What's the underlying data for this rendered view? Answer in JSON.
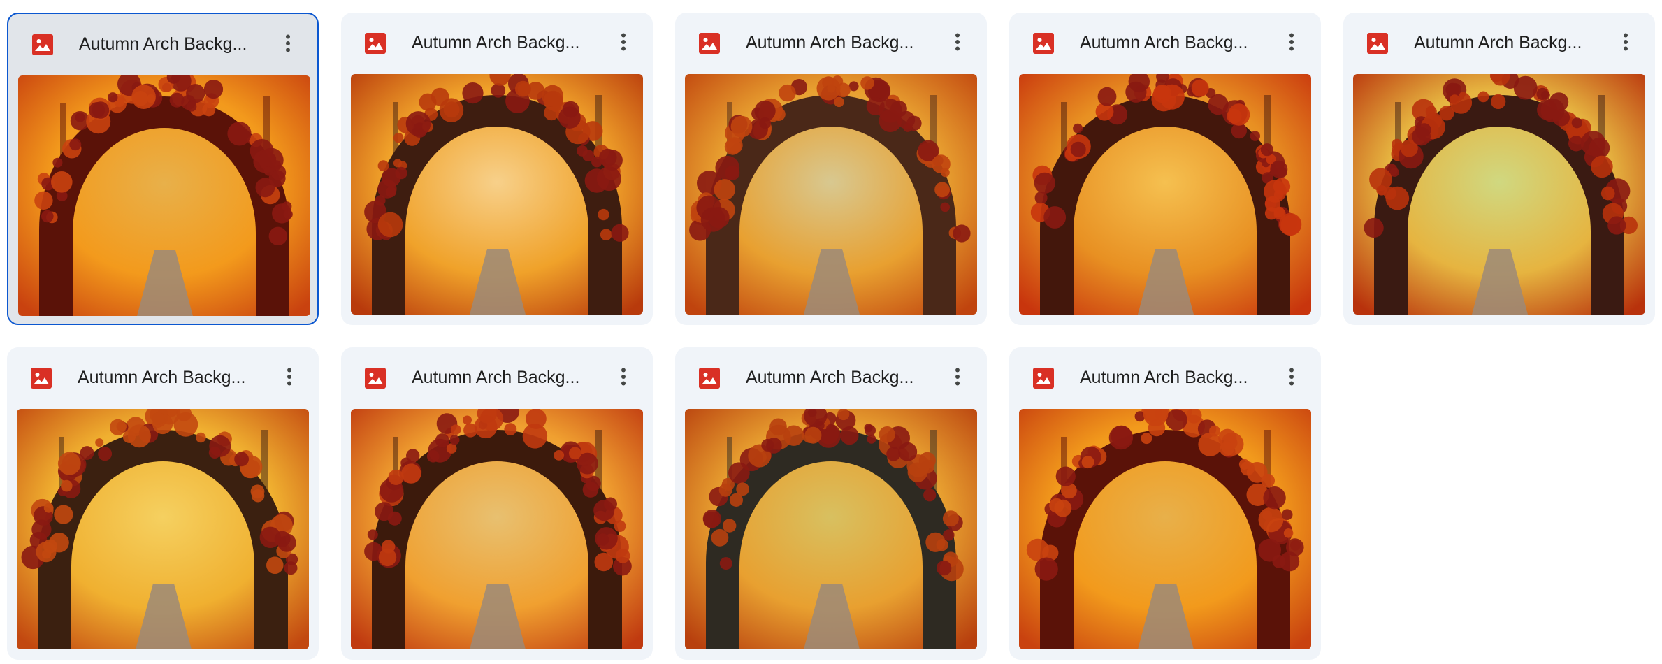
{
  "colors": {
    "card_bg": "#f0f4f9",
    "card_selected_bg": "#e1e5ea",
    "selection_border": "#0b57d0",
    "image_icon": "#d93025",
    "title_text": "#1f1f1f"
  },
  "files": [
    {
      "title": "Autumn Arch Backg...",
      "icon": "image-file-icon",
      "selected": true
    },
    {
      "title": "Autumn Arch Backg...",
      "icon": "image-file-icon",
      "selected": false
    },
    {
      "title": "Autumn Arch Backg...",
      "icon": "image-file-icon",
      "selected": false
    },
    {
      "title": "Autumn Arch Backg...",
      "icon": "image-file-icon",
      "selected": false
    },
    {
      "title": "Autumn Arch Backg...",
      "icon": "image-file-icon",
      "selected": false
    },
    {
      "title": "Autumn Arch Backg...",
      "icon": "image-file-icon",
      "selected": false
    },
    {
      "title": "Autumn Arch Backg...",
      "icon": "image-file-icon",
      "selected": false
    },
    {
      "title": "Autumn Arch Backg...",
      "icon": "image-file-icon",
      "selected": false
    },
    {
      "title": "Autumn Arch Backg...",
      "icon": "image-file-icon",
      "selected": false
    }
  ],
  "more_icon": "more-vertical-icon"
}
